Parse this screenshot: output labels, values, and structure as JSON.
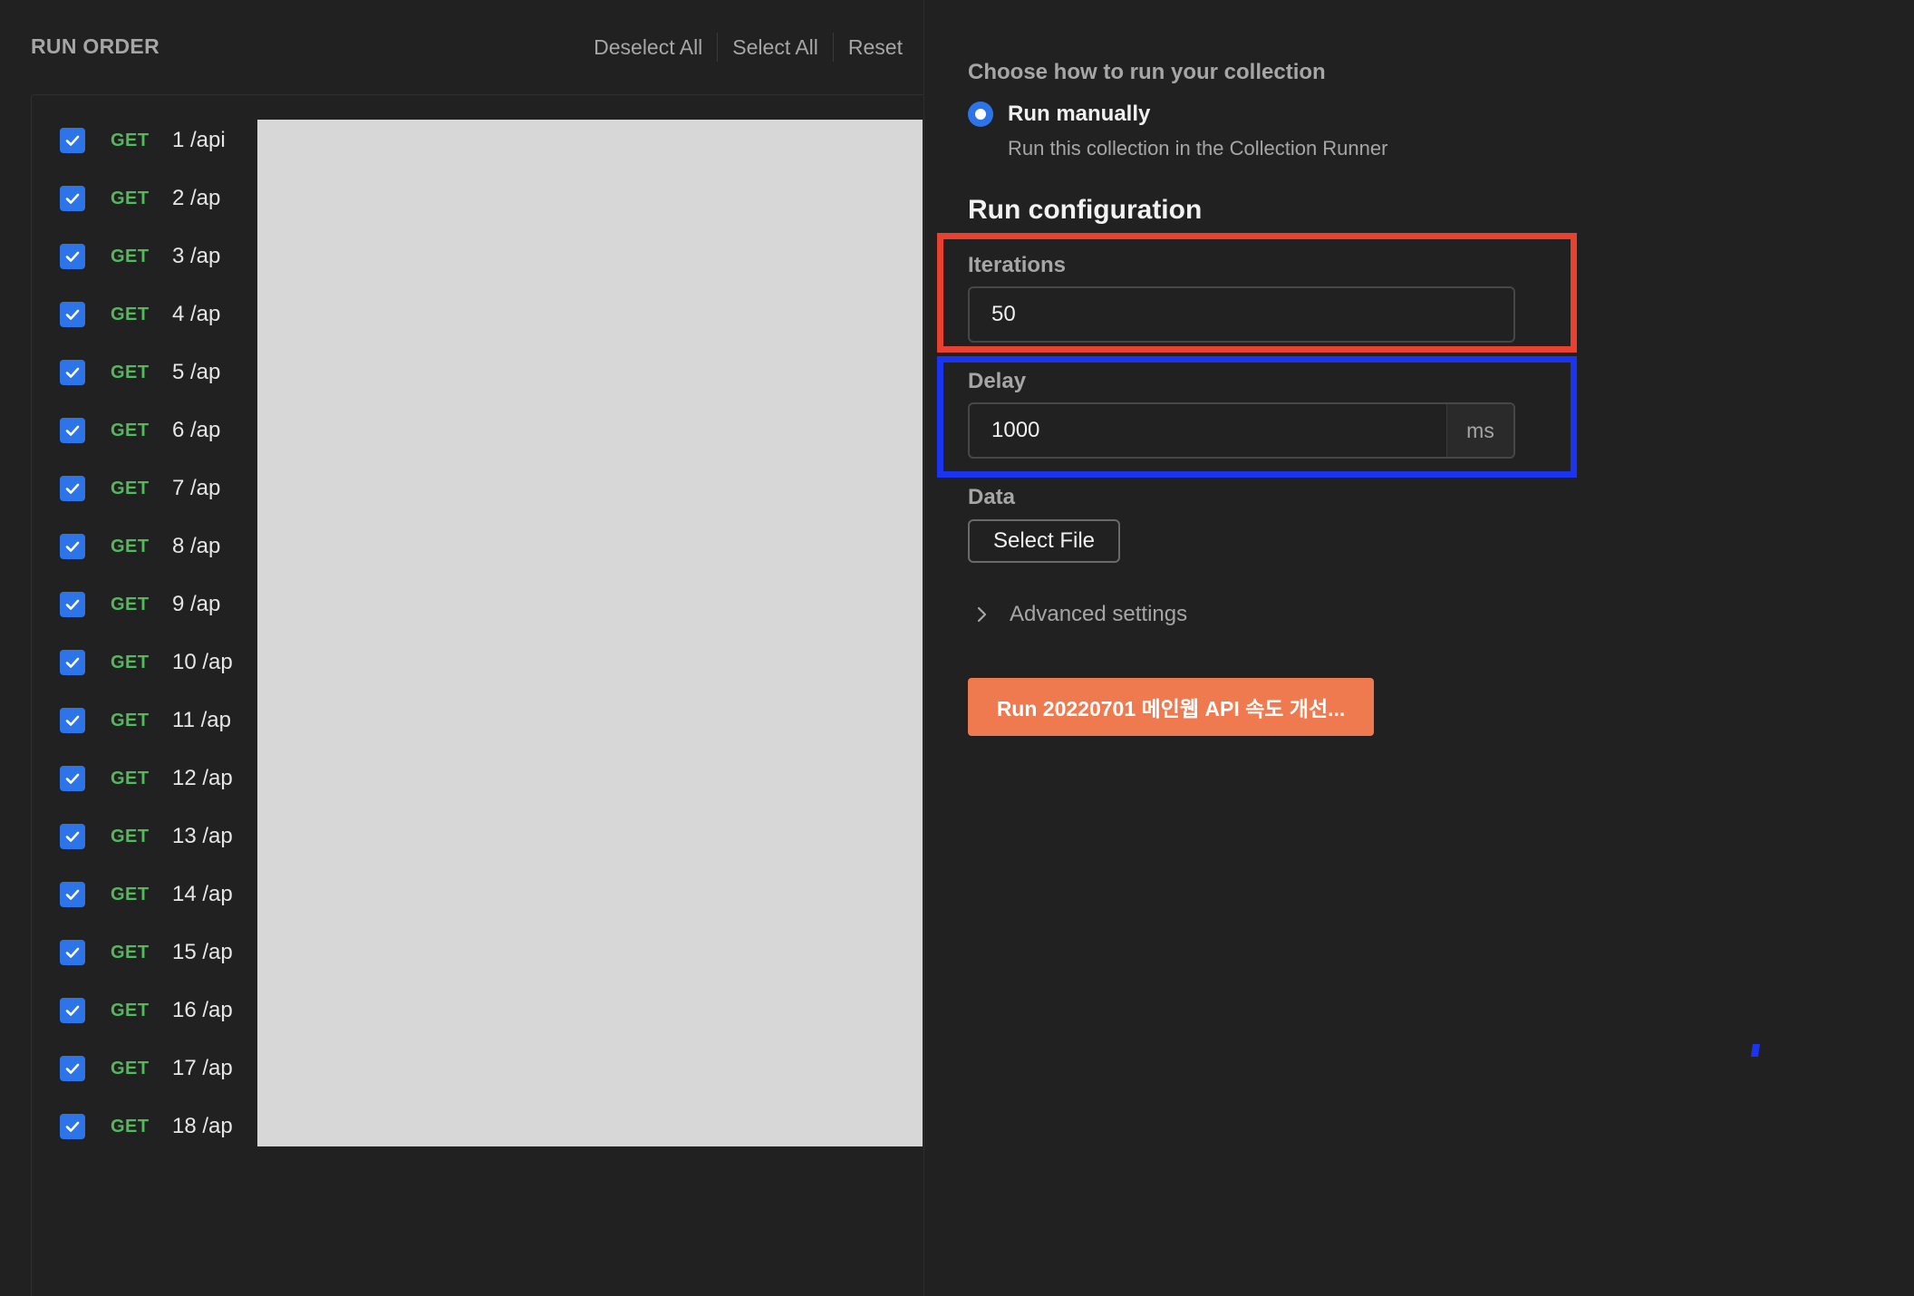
{
  "run_order": {
    "title": "RUN ORDER",
    "actions": [
      "Deselect All",
      "Select All",
      "Reset"
    ],
    "requests": [
      {
        "method": "GET",
        "name": "1 /api",
        "checked": true
      },
      {
        "method": "GET",
        "name": "2 /ap",
        "checked": true
      },
      {
        "method": "GET",
        "name": "3 /ap",
        "checked": true
      },
      {
        "method": "GET",
        "name": "4 /ap",
        "checked": true
      },
      {
        "method": "GET",
        "name": "5 /ap",
        "checked": true
      },
      {
        "method": "GET",
        "name": "6 /ap",
        "checked": true
      },
      {
        "method": "GET",
        "name": "7 /ap",
        "checked": true
      },
      {
        "method": "GET",
        "name": "8 /ap",
        "checked": true
      },
      {
        "method": "GET",
        "name": "9 /ap",
        "checked": true
      },
      {
        "method": "GET",
        "name": "10 /ap",
        "checked": true
      },
      {
        "method": "GET",
        "name": "11 /ap",
        "checked": true
      },
      {
        "method": "GET",
        "name": "12 /ap",
        "checked": true
      },
      {
        "method": "GET",
        "name": "13 /ap",
        "checked": true
      },
      {
        "method": "GET",
        "name": "14 /ap",
        "checked": true
      },
      {
        "method": "GET",
        "name": "15 /ap",
        "checked": true
      },
      {
        "method": "GET",
        "name": "16 /ap",
        "checked": true
      },
      {
        "method": "GET",
        "name": "17 /ap",
        "checked": true
      },
      {
        "method": "GET",
        "name": "18 /ap",
        "checked": true
      }
    ]
  },
  "run_mode": {
    "heading": "Choose how to run your collection",
    "option_label": "Run manually",
    "option_description": "Run this collection in the Collection Runner",
    "selected": true
  },
  "config": {
    "title": "Run configuration",
    "iterations": {
      "label": "Iterations",
      "value": "50"
    },
    "delay": {
      "label": "Delay",
      "value": "1000",
      "unit": "ms"
    },
    "data": {
      "label": "Data",
      "button": "Select File"
    },
    "advanced_label": "Advanced settings",
    "run_button": "Run 20220701 메인웹 API 속도 개선..."
  },
  "colors": {
    "accent_blue": "#2d74e8",
    "method_get": "#55b85b",
    "run_button": "#ef7a4f",
    "highlight_red": "#e8412f",
    "highlight_blue": "#1a34f0"
  }
}
